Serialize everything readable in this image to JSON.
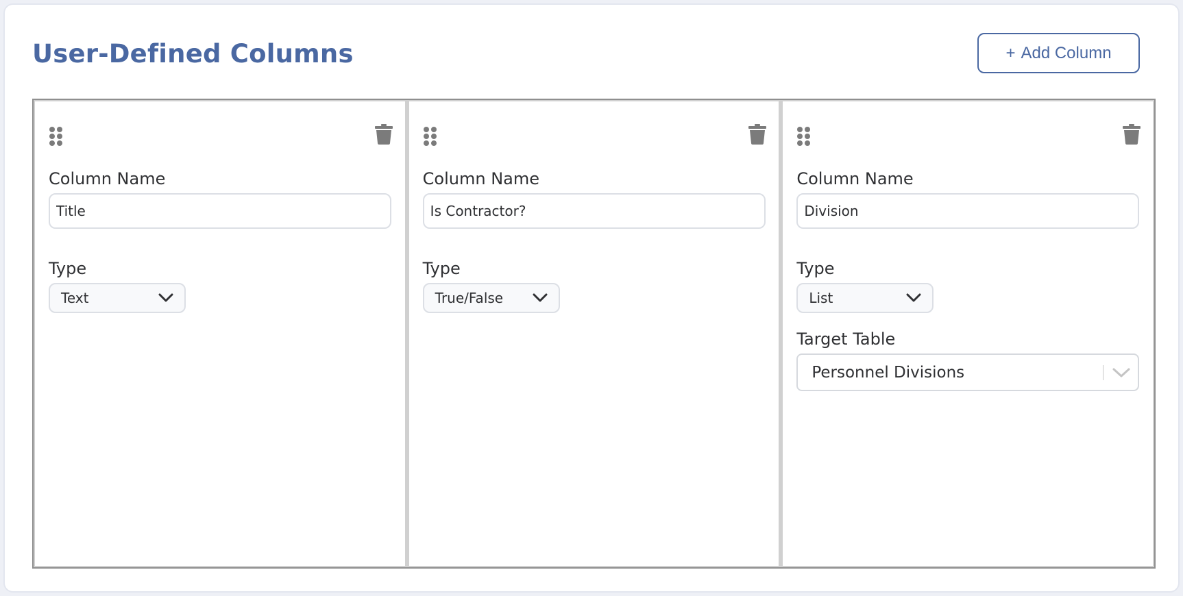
{
  "header": {
    "title": "User-Defined Columns",
    "add_button": {
      "icon": "+",
      "label": "Add Column"
    }
  },
  "columns": [
    {
      "name_label": "Column Name",
      "name_value": "Title",
      "type_label": "Type",
      "type_value": "Text"
    },
    {
      "name_label": "Column Name",
      "name_value": "Is Contractor?",
      "type_label": "Type",
      "type_value": "True/False"
    },
    {
      "name_label": "Column Name",
      "name_value": "Division",
      "type_label": "Type",
      "type_value": "List",
      "target_label": "Target Table",
      "target_value": "Personnel Divisions"
    }
  ],
  "icons": {
    "drag": "drag-handle-icon",
    "delete": "trash-icon",
    "dropdown": "chevron-down-icon"
  },
  "colors": {
    "accent": "#4a68a2",
    "icon_gray": "#7b7b7b",
    "panel_border": "#8f8f8f"
  }
}
